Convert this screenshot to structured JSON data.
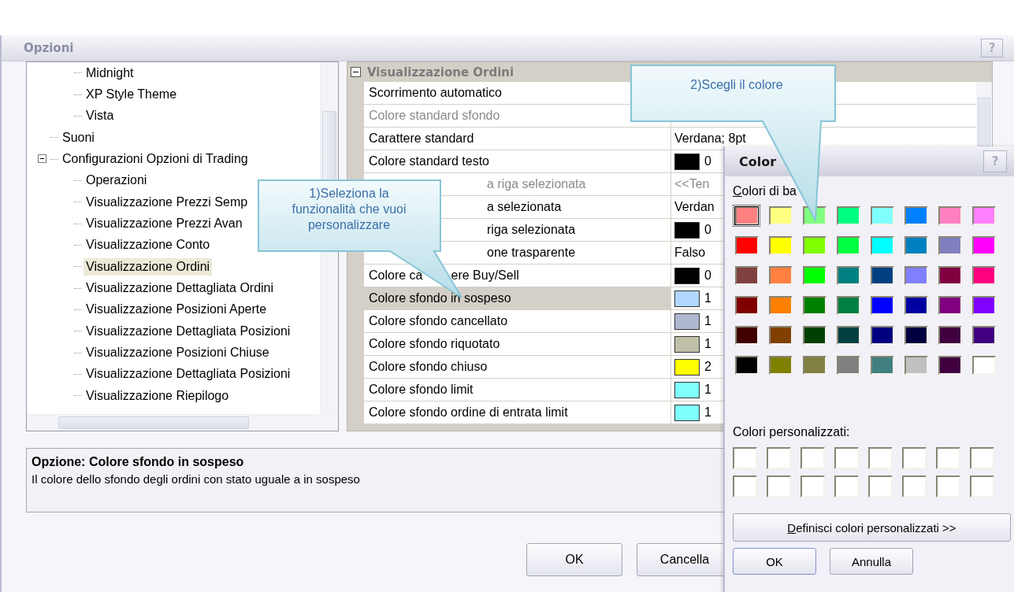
{
  "window": {
    "title": "Opzioni",
    "title_buttons": [
      "?"
    ]
  },
  "tree": {
    "orphan_children": [
      {
        "label": "Midnight",
        "selected": false
      },
      {
        "label": "XP Style Theme",
        "selected": false
      },
      {
        "label": "Vista",
        "selected": false
      }
    ],
    "items": [
      {
        "label": "Suoni",
        "selected": false
      },
      {
        "label": "Configurazioni Opzioni di Trading",
        "selected": false,
        "expanded": true,
        "children": [
          {
            "label": "Operazioni",
            "selected": false
          },
          {
            "label": "Visualizzazione Prezzi Semp",
            "selected": false
          },
          {
            "label": "Visualizzazione Prezzi Avan",
            "selected": false
          },
          {
            "label": "Visualizzazione Conto",
            "selected": false
          },
          {
            "label": "Visualizzazione Ordini",
            "selected": true
          },
          {
            "label": "Visualizzazione Dettagliata Ordini",
            "selected": false
          },
          {
            "label": "Visualizzazione Posizioni Aperte",
            "selected": false
          },
          {
            "label": "Visualizzazione Dettagliata Posizioni",
            "selected": false
          },
          {
            "label": "Visualizzazione Posizioni Chiuse",
            "selected": false
          },
          {
            "label": "Visualizzazione Dettagliata Posizioni",
            "selected": false
          },
          {
            "label": "Visualizzazione Riepilogo",
            "selected": false
          }
        ]
      }
    ]
  },
  "properties": {
    "category": "Visualizzazione Ordini",
    "expanded": true,
    "rows": [
      {
        "label": "Scorrimento automatico",
        "selected": false,
        "disabled": false,
        "kind": "none"
      },
      {
        "label": "Colore standard sfondo",
        "selected": false,
        "disabled": true,
        "kind": "none"
      },
      {
        "label": "Carattere standard",
        "selected": false,
        "disabled": false,
        "kind": "text",
        "value": "Verdana; 8pt"
      },
      {
        "label": "Colore standard testo",
        "selected": false,
        "disabled": false,
        "kind": "color",
        "color": "#000000",
        "value": "0"
      },
      {
        "label": "a riga selezionata",
        "selected": false,
        "disabled": true,
        "covered": true,
        "kind": "text",
        "value": "<<Ten"
      },
      {
        "label": "a selezionata",
        "selected": false,
        "disabled": false,
        "covered": true,
        "kind": "text",
        "value": "Verdan"
      },
      {
        "label": "riga selezionata",
        "selected": false,
        "disabled": false,
        "covered": true,
        "kind": "color",
        "color": "#000000",
        "value": "0"
      },
      {
        "label": "one trasparente",
        "selected": false,
        "disabled": false,
        "covered": true,
        "kind": "text",
        "value": "Falso"
      },
      {
        "label": "Colore ca",
        "label_after": "ere Buy/Sell",
        "selected": false,
        "disabled": false,
        "kind": "color",
        "color": "#000000",
        "value": "0"
      },
      {
        "label": "Colore sfondo in sospeso",
        "selected": true,
        "disabled": false,
        "kind": "color",
        "color": "#b0d8ff",
        "value": "1"
      },
      {
        "label": "Colore sfondo cancellato",
        "selected": false,
        "disabled": false,
        "kind": "color",
        "color": "#b0b8d0",
        "value": "1"
      },
      {
        "label": "Colore sfondo riquotato",
        "selected": false,
        "disabled": false,
        "kind": "color",
        "color": "#c0c0a8",
        "value": "1"
      },
      {
        "label": "Colore sfondo chiuso",
        "selected": false,
        "disabled": false,
        "kind": "color",
        "color": "#ffff00",
        "value": "2"
      },
      {
        "label": "Colore sfondo limit",
        "selected": false,
        "disabled": false,
        "kind": "color",
        "color": "#80ffff",
        "value": "1"
      },
      {
        "label": "Colore sfondo ordine di entrata limit",
        "selected": false,
        "disabled": false,
        "kind": "color",
        "color": "#80ffff",
        "value": "1"
      }
    ]
  },
  "description": {
    "title": "Opzione: Colore sfondo in sospeso",
    "text": "Il colore dello sfondo degli ordini con stato uguale a in sospeso"
  },
  "buttons": [
    "OK",
    "Cancella"
  ],
  "color_dialog": {
    "title": "Color",
    "title_buttons": [
      "?"
    ],
    "basic_label": "Colori di ba",
    "basic_colors": [
      {
        "color": "#ff8080",
        "selected": true
      },
      {
        "color": "#ffff80",
        "selected": false
      },
      {
        "color": "#80ff80",
        "selected": false
      },
      {
        "color": "#00ff80",
        "selected": false
      },
      {
        "color": "#80ffff",
        "selected": false
      },
      {
        "color": "#0080ff",
        "selected": false
      },
      {
        "color": "#ff80c0",
        "selected": false
      },
      {
        "color": "#ff80ff",
        "selected": false
      },
      {
        "color": "#ff0000",
        "selected": false
      },
      {
        "color": "#ffff00",
        "selected": false
      },
      {
        "color": "#80ff00",
        "selected": false
      },
      {
        "color": "#00ff40",
        "selected": false
      },
      {
        "color": "#00ffff",
        "selected": false
      },
      {
        "color": "#0080c0",
        "selected": false
      },
      {
        "color": "#8080c0",
        "selected": false
      },
      {
        "color": "#ff00ff",
        "selected": false
      },
      {
        "color": "#804040",
        "selected": false
      },
      {
        "color": "#ff8040",
        "selected": false
      },
      {
        "color": "#00ff00",
        "selected": false
      },
      {
        "color": "#008080",
        "selected": false
      },
      {
        "color": "#004080",
        "selected": false
      },
      {
        "color": "#8080ff",
        "selected": false
      },
      {
        "color": "#800040",
        "selected": false
      },
      {
        "color": "#ff0080",
        "selected": false
      },
      {
        "color": "#800000",
        "selected": false
      },
      {
        "color": "#ff8000",
        "selected": false
      },
      {
        "color": "#008000",
        "selected": false
      },
      {
        "color": "#008040",
        "selected": false
      },
      {
        "color": "#0000ff",
        "selected": false
      },
      {
        "color": "#0000a0",
        "selected": false
      },
      {
        "color": "#800080",
        "selected": false
      },
      {
        "color": "#8000ff",
        "selected": false
      },
      {
        "color": "#400000",
        "selected": false
      },
      {
        "color": "#804000",
        "selected": false
      },
      {
        "color": "#004000",
        "selected": false
      },
      {
        "color": "#004040",
        "selected": false
      },
      {
        "color": "#000080",
        "selected": false
      },
      {
        "color": "#000040",
        "selected": false
      },
      {
        "color": "#400040",
        "selected": false
      },
      {
        "color": "#400080",
        "selected": false
      },
      {
        "color": "#000000",
        "selected": false
      },
      {
        "color": "#808000",
        "selected": false
      },
      {
        "color": "#808040",
        "selected": false
      },
      {
        "color": "#808080",
        "selected": false
      },
      {
        "color": "#408080",
        "selected": false
      },
      {
        "color": "#c0c0c0",
        "selected": false
      },
      {
        "color": "#400040",
        "selected": false
      },
      {
        "color": "#ffffff",
        "selected": false
      }
    ],
    "custom_label": "Colori personalizzati:",
    "custom_colors": [
      {
        "color": "#ffffff"
      },
      {
        "color": "#ffffff"
      },
      {
        "color": "#ffffff"
      },
      {
        "color": "#ffffff"
      },
      {
        "color": "#ffffff"
      },
      {
        "color": "#ffffff"
      },
      {
        "color": "#ffffff"
      },
      {
        "color": "#ffffff"
      },
      {
        "color": "#ffffff"
      },
      {
        "color": "#ffffff"
      },
      {
        "color": "#ffffff"
      },
      {
        "color": "#ffffff"
      },
      {
        "color": "#ffffff"
      },
      {
        "color": "#ffffff"
      },
      {
        "color": "#ffffff"
      },
      {
        "color": "#ffffff"
      }
    ],
    "define_button": "Definisci colori personalizzati >>",
    "buttons": [
      "OK",
      "Annulla"
    ]
  },
  "callouts": [
    {
      "text": "1)Seleziona la funzionalità che vuoi personalizzare"
    },
    {
      "text": "2)Scegli il colore"
    }
  ]
}
